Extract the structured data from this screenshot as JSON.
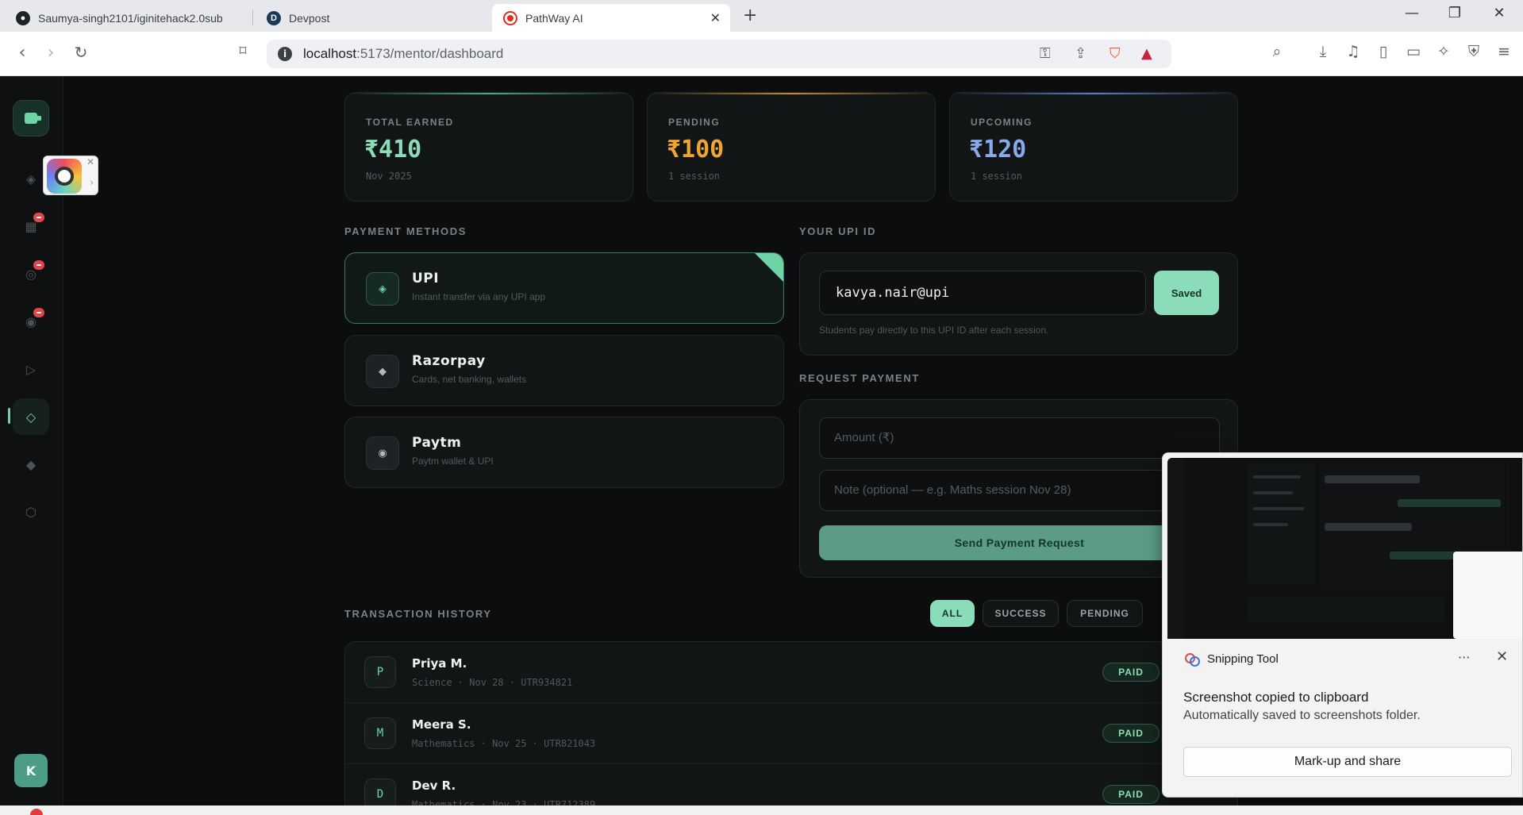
{
  "browser": {
    "tabs": [
      {
        "label": "Saumya-singh2101/iginitehack2.0sub",
        "favicon": "github-icon",
        "active": false
      },
      {
        "label": "Devpost",
        "favicon": "devpost-icon",
        "active": false
      },
      {
        "label": "PathWay AI",
        "favicon": "recording-icon",
        "active": true
      }
    ],
    "url_host": "localhost",
    "url_rest": ":5173/mentor/dashboard"
  },
  "sidebar": {
    "avatar_initial": "K",
    "nav_icons": [
      "diamond-icon",
      "grid-icon",
      "target-icon",
      "circle-icon",
      "play-icon",
      "wallet-icon",
      "spark-icon",
      "hexagon-icon"
    ],
    "active_item": "wallet-icon"
  },
  "stats": [
    {
      "label": "TOTAL EARNED",
      "value": "₹410",
      "sub": "Nov 2025",
      "color": "#8bdcb8",
      "accent": "#4aa886"
    },
    {
      "label": "PENDING",
      "value": "₹100",
      "sub": "1 session",
      "color": "#f0a431",
      "accent": "#c98a2b"
    },
    {
      "label": "UPCOMING",
      "value": "₹120",
      "sub": "1 session",
      "color": "#8aa9ec",
      "accent": "#5d7bc4"
    }
  ],
  "payment_methods": {
    "title": "PAYMENT METHODS",
    "items": [
      {
        "name": "UPI",
        "desc": "Instant transfer via any UPI app",
        "icon": "◈",
        "selected": true
      },
      {
        "name": "Razorpay",
        "desc": "Cards, net banking, wallets",
        "icon": "◆",
        "selected": false
      },
      {
        "name": "Paytm",
        "desc": "Paytm wallet & UPI",
        "icon": "◉",
        "selected": false
      }
    ]
  },
  "upi": {
    "title": "YOUR UPI ID",
    "value": "kavya.nair@upi",
    "saved_label": "Saved",
    "hint": "Students pay directly to this UPI ID after each session."
  },
  "request": {
    "title": "REQUEST PAYMENT",
    "amount_placeholder": "Amount (₹)",
    "note_placeholder": "Note (optional — e.g. Maths session Nov 28)",
    "send_label": "Send Payment Request"
  },
  "transactions": {
    "title": "TRANSACTION HISTORY",
    "filters": [
      "ALL",
      "SUCCESS",
      "PENDING"
    ],
    "active_filter": "ALL",
    "rows": [
      {
        "initial": "P",
        "name": "Priya M.",
        "meta": "Science · Nov 28 · UTR934821",
        "status": "PAID"
      },
      {
        "initial": "M",
        "name": "Meera S.",
        "meta": "Mathematics · Nov 25 · UTR821043",
        "status": "PAID"
      },
      {
        "initial": "D",
        "name": "Dev R.",
        "meta": "Mathematics · Nov 23 · UTR712389",
        "status": "PAID"
      }
    ]
  },
  "snipping_toast": {
    "app_name": "Snipping Tool",
    "title": "Screenshot copied to clipboard",
    "subtitle": "Automatically saved to screenshots folder.",
    "share_label": "Mark-up and share"
  }
}
